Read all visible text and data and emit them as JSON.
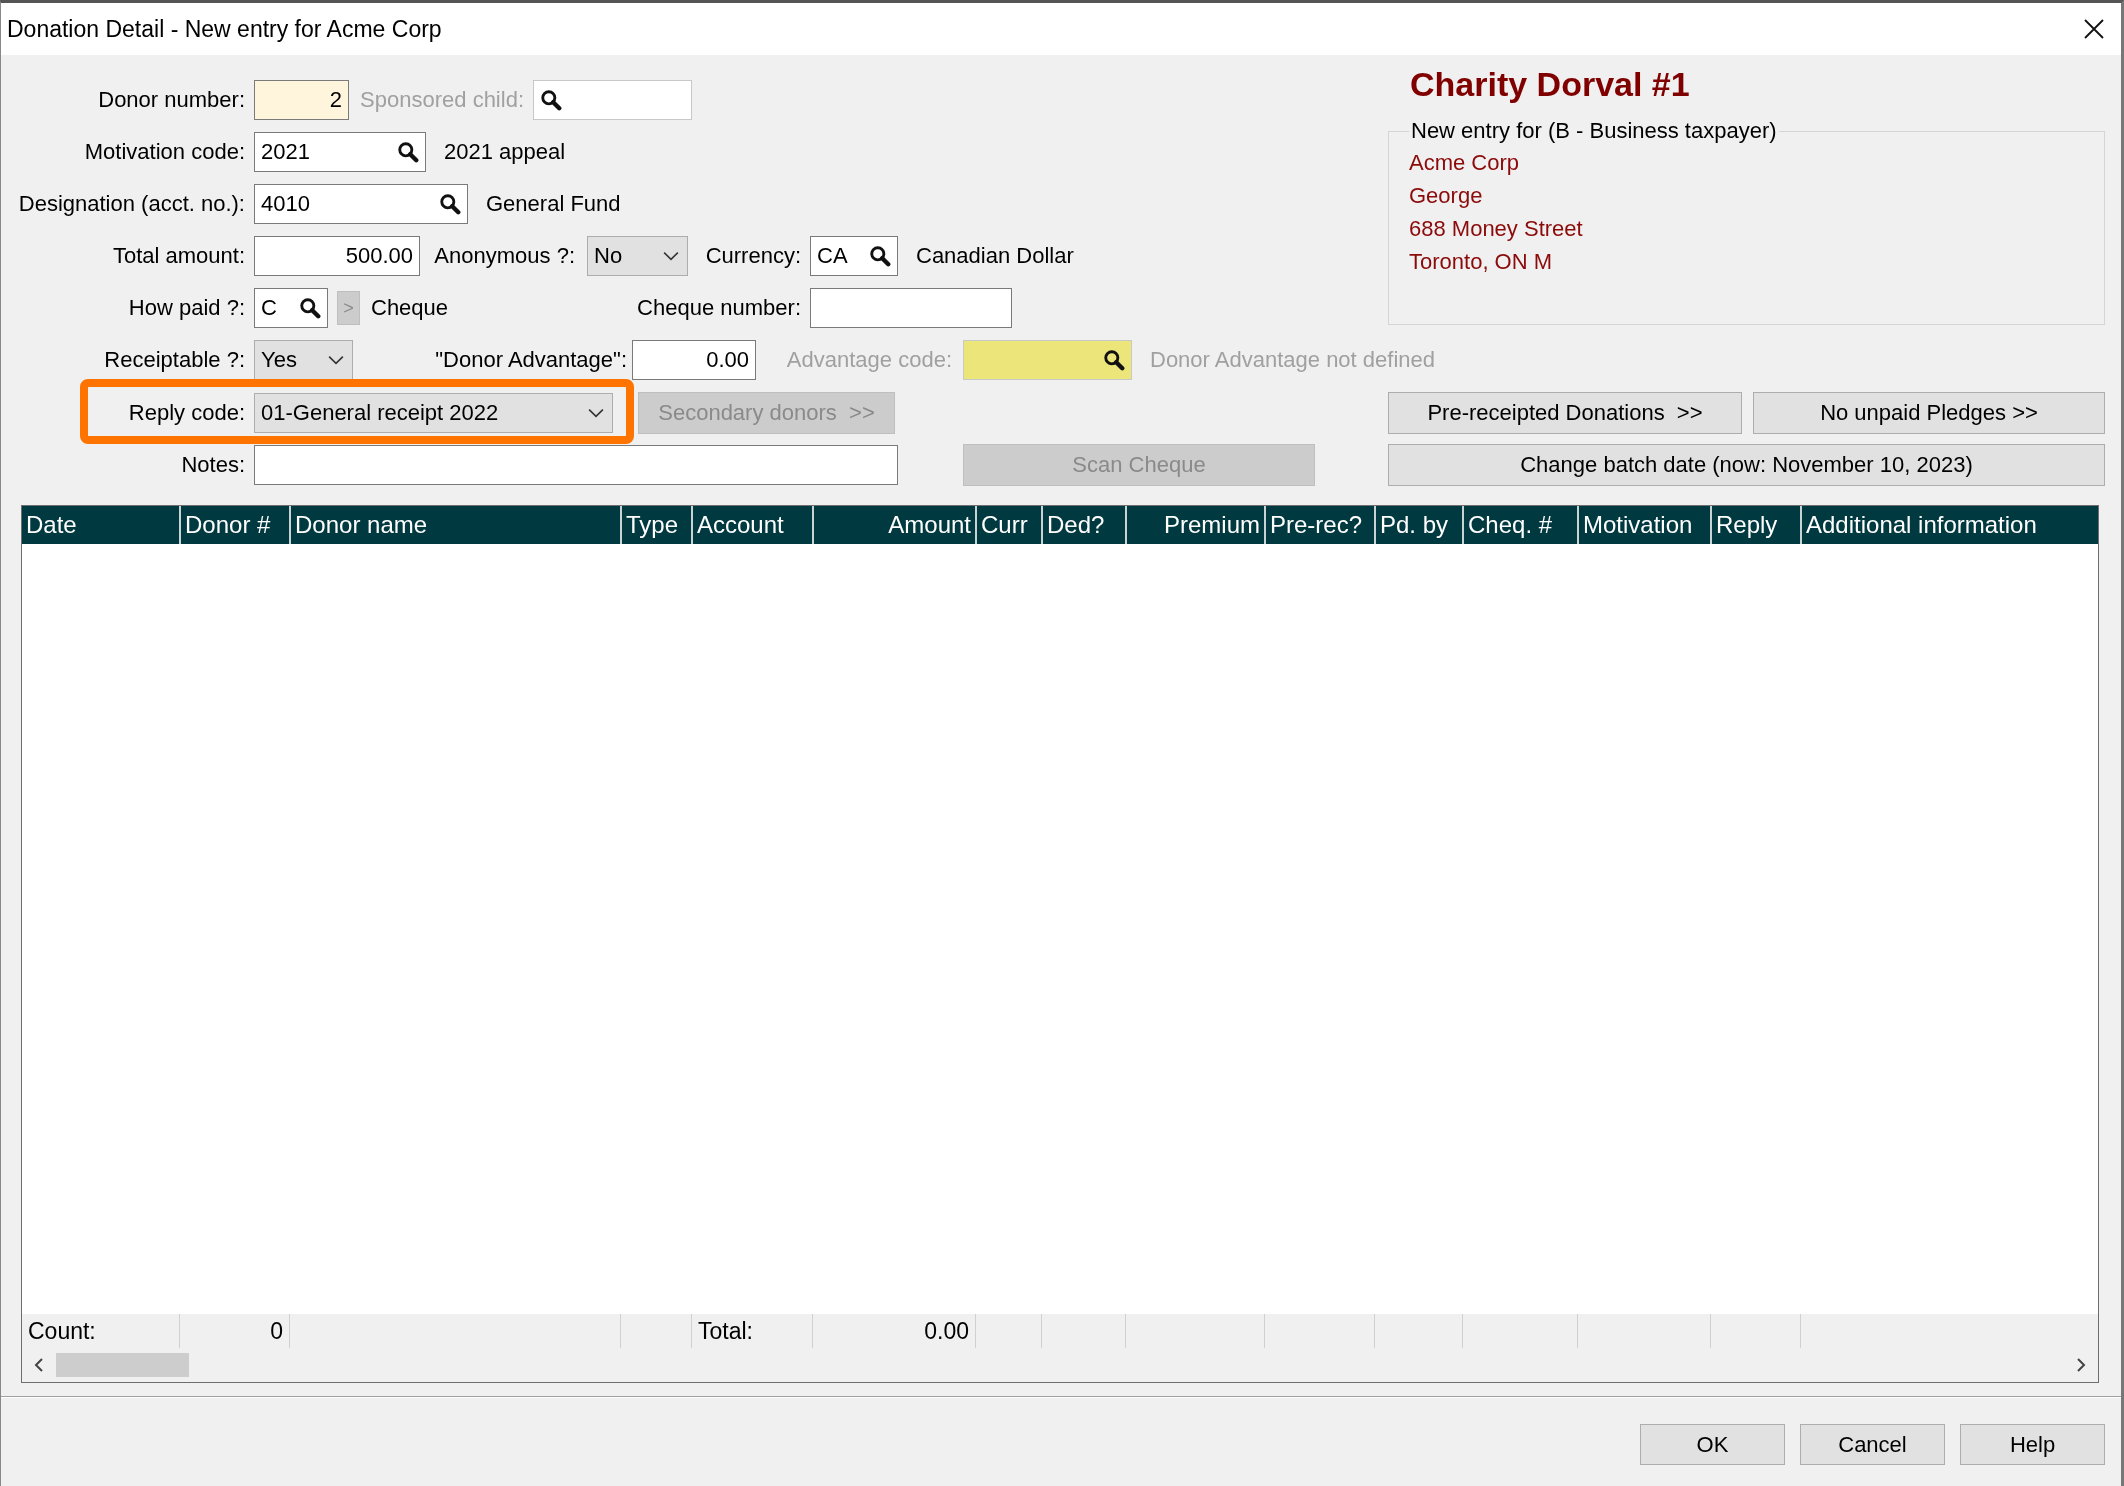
{
  "window": {
    "title": "Donation Detail - New entry for Acme Corp"
  },
  "donor_number": {
    "label": "Donor number:",
    "value": "2"
  },
  "sponsored_child": {
    "label": "Sponsored child:",
    "disabled": true
  },
  "motivation_code": {
    "label": "Motivation code:",
    "value": "2021",
    "description": "2021 appeal"
  },
  "designation": {
    "label": "Designation (acct. no.):",
    "value": "4010",
    "description": "General Fund"
  },
  "total_amount": {
    "label": "Total amount:",
    "value": "500.00"
  },
  "anonymous": {
    "label": "Anonymous ?:",
    "value": "No"
  },
  "currency": {
    "label": "Currency:",
    "value": "CA",
    "description": "Canadian Dollar"
  },
  "how_paid": {
    "label": "How paid ?:",
    "value": "C",
    "more_button": ">",
    "more_disabled": true,
    "description": "Cheque"
  },
  "cheque_number": {
    "label": "Cheque number:"
  },
  "receiptable": {
    "label": "Receiptable ?:",
    "value": "Yes"
  },
  "donor_advantage": {
    "label": "\"Donor Advantage\":",
    "value": "0.00"
  },
  "advantage_code": {
    "label": "Advantage code:",
    "disabled": true,
    "description": "Donor Advantage not defined"
  },
  "reply_code": {
    "label": "Reply code:",
    "value": "01-General receipt 2022",
    "highlighted": true
  },
  "secondary_donors": {
    "label": "Secondary donors  >>",
    "disabled": true
  },
  "notes": {
    "label": "Notes:"
  },
  "scan_cheque": {
    "label": "Scan Cheque",
    "disabled": true
  },
  "charity": {
    "name": "Charity Dorval #1",
    "group_title": "New entry for (B - Business taxpayer)",
    "address": [
      "Acme Corp",
      "George",
      "688 Money Street",
      "Toronto, ON  M"
    ]
  },
  "pre_receipted": {
    "label": "Pre-receipted Donations  >>"
  },
  "unpaid_pledges": {
    "label": "No unpaid Pledges >>"
  },
  "change_batch_date": {
    "label": "Change batch date (now: November 10, 2023)"
  },
  "table": {
    "columns": [
      "Date",
      "Donor #",
      "Donor name",
      "Type",
      "Account",
      "Amount",
      "Curr",
      "Ded?",
      "Premium",
      "Pre-rec?",
      "Pd. by",
      "Cheq. #",
      "Motivation",
      "Reply",
      "Additional information"
    ],
    "footer": {
      "count_label": "Count:",
      "count": "0",
      "total_label": "Total:",
      "total": "0.00"
    }
  },
  "dialog_buttons": [
    "OK",
    "Cancel",
    "Help"
  ]
}
